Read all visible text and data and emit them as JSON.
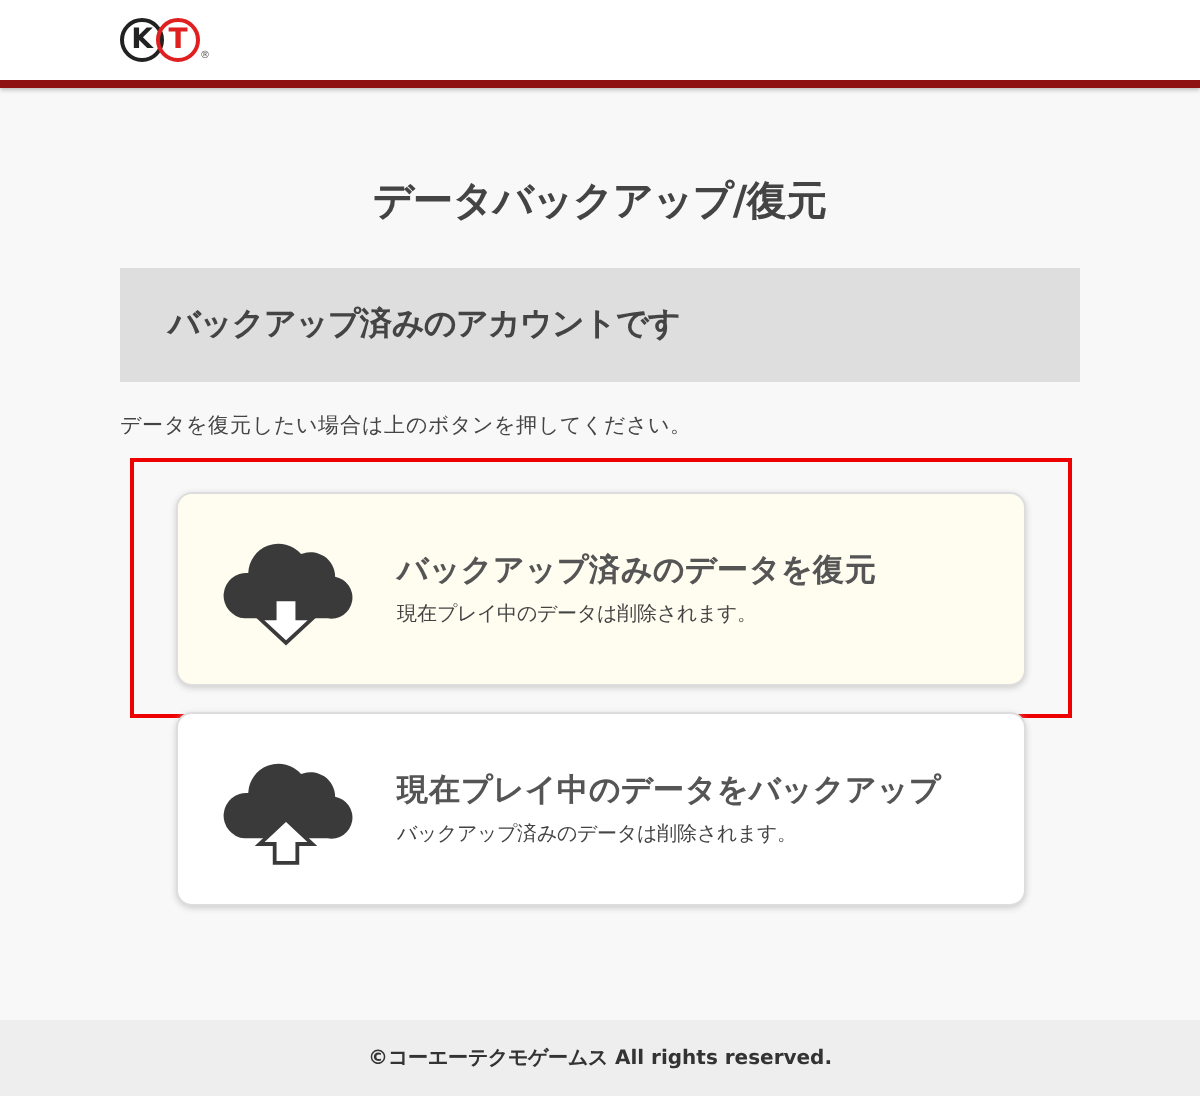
{
  "logo": {
    "letters": [
      "K",
      "T"
    ],
    "mark": "®"
  },
  "title": "データバックアップ/復元",
  "status_box": "バックアップ済みのアカウントです",
  "note": "データを復元したい場合は上のボタンを押してください。",
  "options": [
    {
      "kind": "download",
      "selected": true,
      "label": "バックアップ済みのデータを復元",
      "sub": "現在プレイ中のデータは削除されます。"
    },
    {
      "kind": "upload",
      "selected": false,
      "label": "現在プレイ中のデータをバックアップ",
      "sub": "バックアップ済みのデータは削除されます。"
    }
  ],
  "footer": "©コーエーテクモゲームス All rights reserved."
}
